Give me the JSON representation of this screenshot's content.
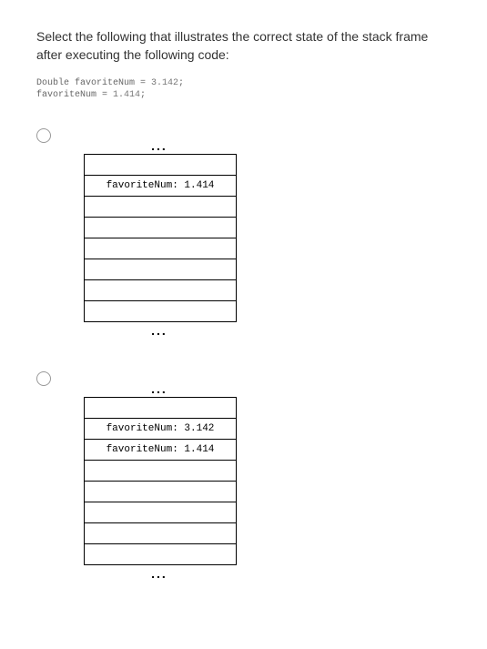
{
  "question": "Select the following that illustrates the correct state of the stack frame after executing the following code:",
  "code": {
    "line1_pre": "Double favoriteNum = ",
    "line1_val": "3.142",
    "line1_post": ";",
    "line2_pre": "favoriteNum = ",
    "line2_val": "1.414",
    "line2_post": ";"
  },
  "ellipsis": "...",
  "options": [
    {
      "rows": [
        "",
        "favoriteNum: 1.414",
        "",
        "",
        "",
        "",
        "",
        ""
      ]
    },
    {
      "rows": [
        "",
        "favoriteNum: 3.142",
        "favoriteNum: 1.414",
        "",
        "",
        "",
        "",
        ""
      ]
    }
  ]
}
